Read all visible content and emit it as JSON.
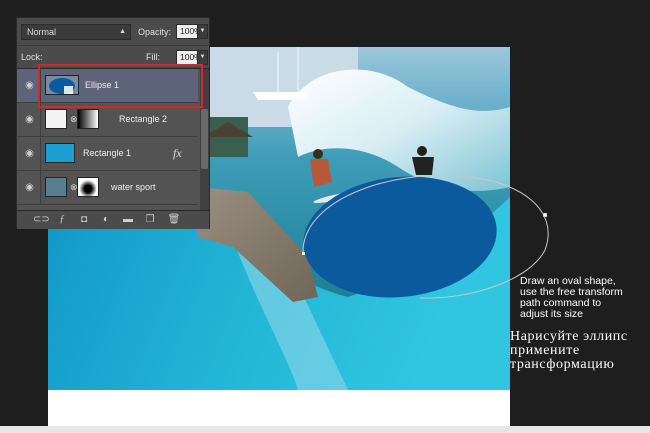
{
  "layers_panel": {
    "blend_mode": "Normal",
    "opacity_label": "Opacity:",
    "opacity_value": "100%",
    "lock_label": "Lock:",
    "fill_label": "Fill:",
    "fill_value": "100%",
    "layers": [
      {
        "name": "Ellipse 1",
        "selected": true
      },
      {
        "name": "Rectangle 2",
        "selected": false
      },
      {
        "name": "Rectangle 1",
        "selected": false,
        "fx": "fx"
      },
      {
        "name": "water sport",
        "selected": false
      }
    ]
  },
  "annotation_en": {
    "line1": "Draw an oval shape,",
    "line2": "use the free transform",
    "line3": "path command to",
    "line4": "adjust its size"
  },
  "annotation_ru": {
    "line1": "Нарисуйте эллипс",
    "line2": "примените",
    "line3": "трансформацию"
  },
  "colors": {
    "background": "#1e1e1e",
    "ellipse": "#0c5a9e",
    "cyan": "#1fb3cf",
    "selection": "#d12a2a"
  }
}
